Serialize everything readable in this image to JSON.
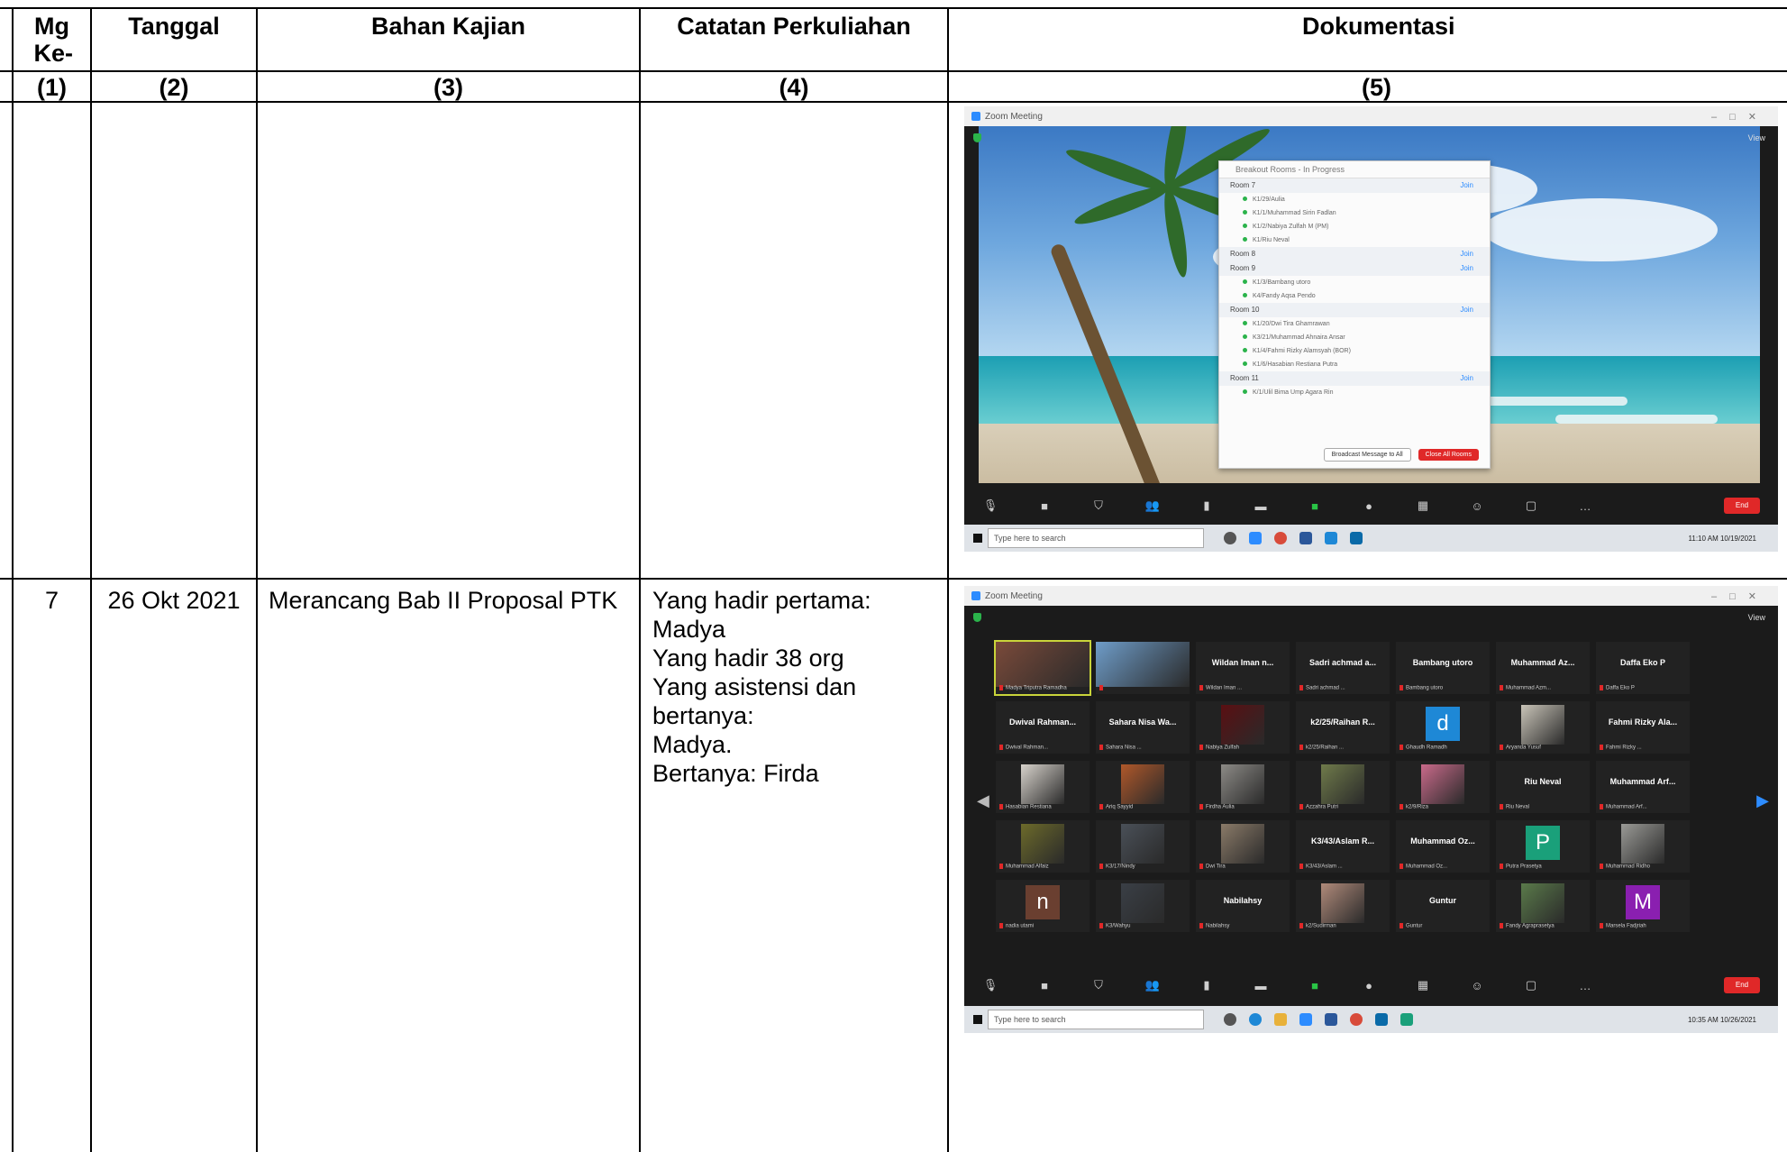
{
  "header": {
    "col1": "Mg Ke-",
    "col2": "Tanggal",
    "col3": "Bahan Kajian",
    "col4": "Catatan Perkuliahan",
    "col5": "Dokumentasi"
  },
  "numbers": [
    "(1)",
    "(2)",
    "(3)",
    "(4)",
    "(5)"
  ],
  "row7": {
    "mg": "7",
    "tanggal": "26 Okt 2021",
    "bahan": "Merancang Bab II Proposal PTK",
    "catatan_lines": [
      "Yang hadir pertama: Madya",
      "Yang hadir 38 org",
      "Yang asistensi dan bertanya:",
      "Madya.",
      "Bertanya: Firda"
    ]
  },
  "shot1": {
    "window_title": "Zoom Meeting",
    "view_label": "View",
    "panel_title": "Breakout Rooms - In Progress",
    "rooms": [
      {
        "name": "Room 7",
        "join": "Join",
        "members": [
          "K1/29/Aulia",
          "K1/1/Muhammad Sirin Fadlan",
          "K1/2/Nabiya Zulfah M (PM)",
          "K1/Riu Neval"
        ]
      },
      {
        "name": "Room 8",
        "join": "Join",
        "members": []
      },
      {
        "name": "Room 9",
        "join": "Join",
        "members": [
          "K1/3/Bambang utoro",
          "K4/Fandy Aqsa Pendo"
        ]
      },
      {
        "name": "Room 10",
        "join": "Join",
        "members": [
          "K1/20/Dwi Tira Ghamrawan",
          "K3/21/Muhammad Ahnaira Ansar",
          "K1/4/Fahmi Rizky Alamsyah (BOR)",
          "K1/6/Hasabian Restiana Putra"
        ]
      },
      {
        "name": "Room 11",
        "join": "Join",
        "members": [
          "K/1/Ulil Bima Ump Agara Rin"
        ]
      }
    ],
    "btn_broadcast": "Broadcast Message to All",
    "btn_close": "Close All Rooms",
    "end_label": "End",
    "search_placeholder": "Type here to search",
    "clock": "11:10 AM 10/19/2021"
  },
  "shot2": {
    "window_title": "Zoom Meeting",
    "view_label": "View",
    "tiles": [
      {
        "name": "",
        "label": "Madya Triputra Ramadha",
        "kind": "photo",
        "color": "#7a4a3a"
      },
      {
        "name": "",
        "label": "",
        "kind": "photo",
        "color": "#6e9cc8"
      },
      {
        "name": "Wildan Iman n...",
        "label": "Wildan Iman ...",
        "kind": "name"
      },
      {
        "name": "Sadri achmad a...",
        "label": "Sadri achmad ...",
        "kind": "name"
      },
      {
        "name": "Bambang utoro",
        "label": "Bambang utoro",
        "kind": "name"
      },
      {
        "name": "Muhammad Az...",
        "label": "Muhammad Azm...",
        "kind": "name"
      },
      {
        "name": "Daffa Eko P",
        "label": "Daffa Eko P",
        "kind": "name"
      },
      {
        "name": "Dwival Rahman...",
        "label": "Dwival Rahman...",
        "kind": "name"
      },
      {
        "name": "Sahara Nisa Wa...",
        "label": "Sahara Nisa ...",
        "kind": "name"
      },
      {
        "name": "",
        "label": "Nabiya Zulfah",
        "kind": "photo",
        "color": "#5a0f12"
      },
      {
        "name": "k2/25/Raihan R...",
        "label": "k2/25/Raihan ...",
        "kind": "name"
      },
      {
        "name": "",
        "label": "Ghaudh Ramadh",
        "kind": "avatar",
        "letter": "d",
        "color": "#1e88d6"
      },
      {
        "name": "",
        "label": "Aryanda Yusuf",
        "kind": "photo",
        "color": "#c9c4b8"
      },
      {
        "name": "Fahmi Rizky Ala...",
        "label": "Fahmi Rizky ...",
        "kind": "name"
      },
      {
        "name": "",
        "label": "Hasabian Restiana",
        "kind": "photo",
        "color": "#d8d3cc"
      },
      {
        "name": "",
        "label": "Ariq Sayyid",
        "kind": "photo",
        "color": "#b0582a"
      },
      {
        "name": "",
        "label": "Firdha Aulia",
        "kind": "photo",
        "color": "#8c8a86"
      },
      {
        "name": "",
        "label": "Azzahra Putri",
        "kind": "photo",
        "color": "#6f7a4a"
      },
      {
        "name": "",
        "label": "k2/9/Riza",
        "kind": "photo",
        "color": "#c96a8a"
      },
      {
        "name": "Riu Neval",
        "label": "Riu Neval",
        "kind": "name"
      },
      {
        "name": "Muhammad Arf...",
        "label": "Muhammad Arf...",
        "kind": "name"
      },
      {
        "name": "",
        "label": "Muhammad Alfaiz",
        "kind": "photo",
        "color": "#6c6a2a"
      },
      {
        "name": "",
        "label": "K3/17/Nindy",
        "kind": "photo",
        "color": "#4a5058"
      },
      {
        "name": "",
        "label": "Dwi Tira",
        "kind": "photo",
        "color": "#8a7a68"
      },
      {
        "name": "K3/43/Aslam R...",
        "label": "K3/43/Aslam ...",
        "kind": "name"
      },
      {
        "name": "Muhammad Oz...",
        "label": "Muhammad Oz...",
        "kind": "name"
      },
      {
        "name": "",
        "label": "Putra Prasetya",
        "kind": "avatar",
        "letter": "P",
        "color": "#1aa07a"
      },
      {
        "name": "",
        "label": "Muhammad Ridho",
        "kind": "photo",
        "color": "#9a9a96"
      },
      {
        "name": "",
        "label": "nadia utami",
        "kind": "avatar",
        "letter": "n",
        "color": "#6a3f30"
      },
      {
        "name": "",
        "label": "K3/Wahyu",
        "kind": "photo",
        "color": "#3a3f46"
      },
      {
        "name": "Nabilahsy",
        "label": "Nabilahsy",
        "kind": "name"
      },
      {
        "name": "",
        "label": "k2/Sudirman",
        "kind": "photo",
        "color": "#b08a7a"
      },
      {
        "name": "Guntur",
        "label": "Guntur",
        "kind": "name"
      },
      {
        "name": "",
        "label": "Fandy Agraprasetya",
        "kind": "photo",
        "color": "#5a7a4a"
      },
      {
        "name": "",
        "label": "Marsela Fadjriah",
        "kind": "avatar",
        "letter": "M",
        "color": "#8a1fb0"
      }
    ],
    "end_label": "End",
    "search_placeholder": "Type here to search",
    "clock": "10:35 AM 10/26/2021"
  }
}
